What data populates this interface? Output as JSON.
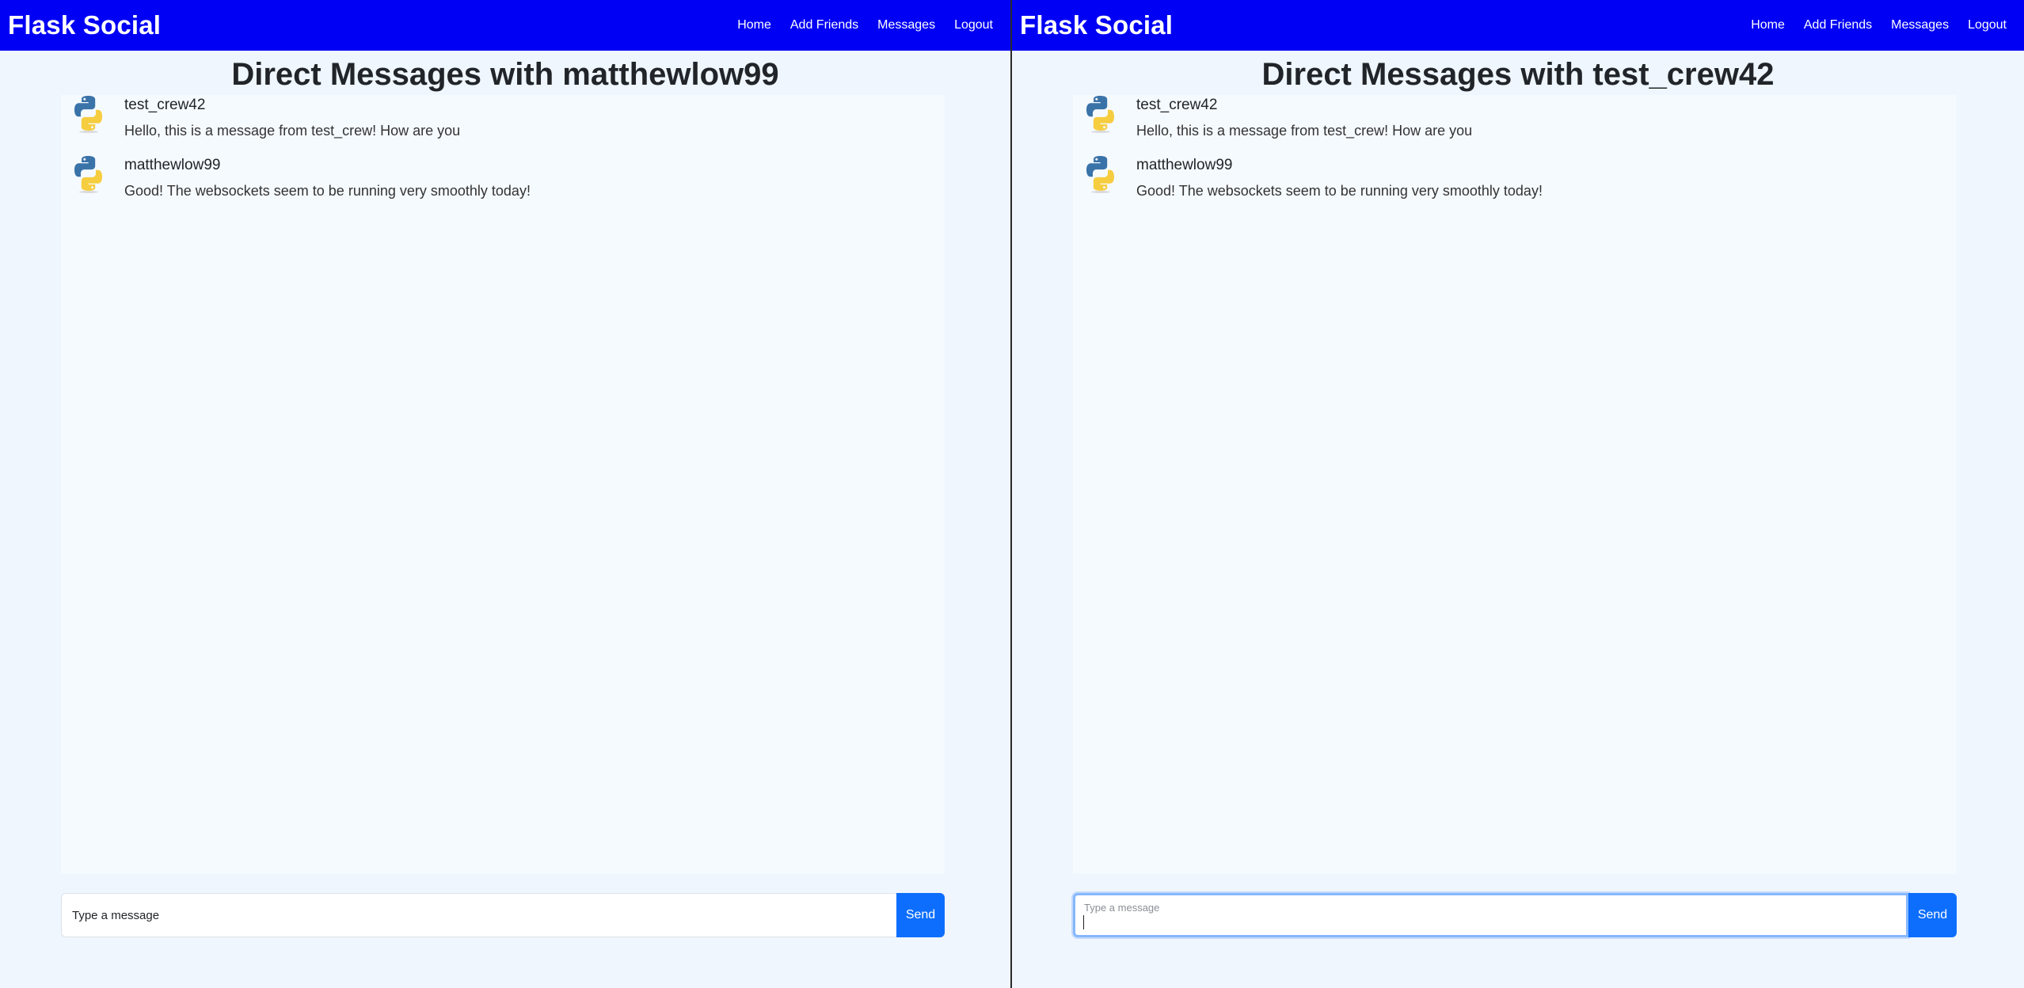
{
  "colors": {
    "navbar": "#0000f5",
    "accent": "#0d6efd",
    "background": "#eff6fe"
  },
  "left": {
    "brand": "Flask Social",
    "nav": [
      "Home",
      "Add Friends",
      "Messages",
      "Logout"
    ],
    "title": "Direct Messages with matthewlow99",
    "messages": [
      {
        "user": "test_crew42",
        "text": "Hello, this is a message from test_crew! How are you",
        "avatar": "python-logo-icon"
      },
      {
        "user": "matthewlow99",
        "text": "Good! The websockets seem to be running very smoothly today!",
        "avatar": "python-logo-icon"
      }
    ],
    "input_placeholder": "Type a message",
    "send_label": "Send"
  },
  "right": {
    "brand": "Flask Social",
    "nav": [
      "Home",
      "Add Friends",
      "Messages",
      "Logout"
    ],
    "title": "Direct Messages with test_crew42",
    "messages": [
      {
        "user": "test_crew42",
        "text": "Hello, this is a message from test_crew! How are you",
        "avatar": "python-logo-icon"
      },
      {
        "user": "matthewlow99",
        "text": "Good! The websockets seem to be running very smoothly today!",
        "avatar": "python-logo-icon"
      }
    ],
    "input_placeholder": "Type a message",
    "send_label": "Send"
  }
}
